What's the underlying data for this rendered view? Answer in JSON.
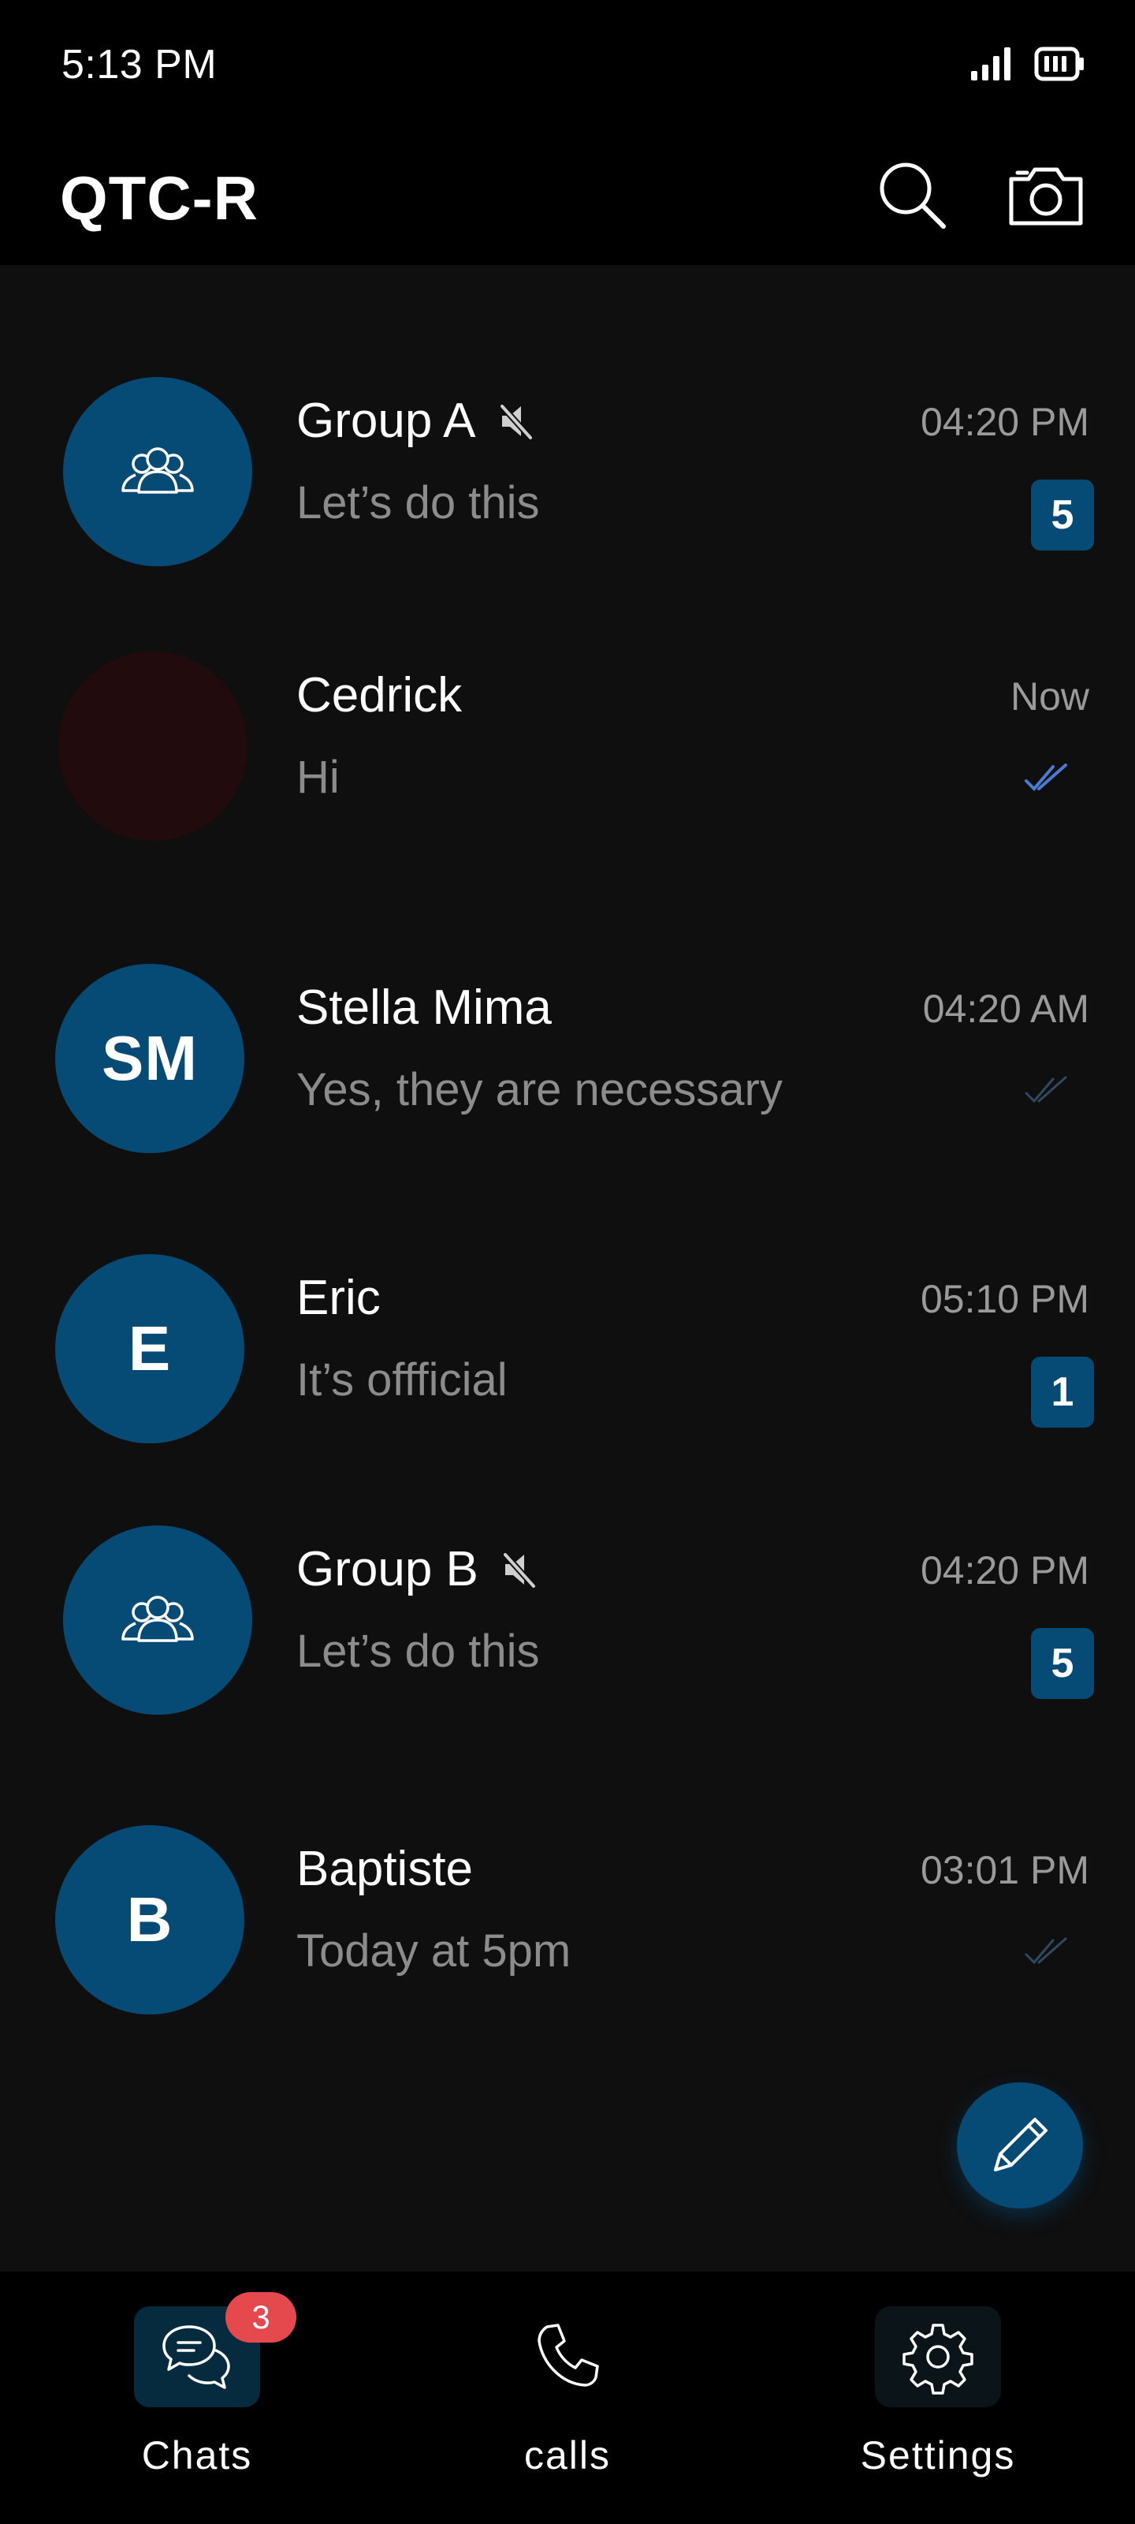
{
  "status_bar": {
    "time": "5:13 PM"
  },
  "header": {
    "title": "QTC-R"
  },
  "chats": [
    {
      "name": "Group A",
      "avatar_text": "",
      "avatar_type": "group-icon",
      "muted": true,
      "message": "Let’s do this",
      "time": "04:20 PM",
      "unread": "5",
      "read_status": null
    },
    {
      "name": "Cedrick",
      "avatar_text": "",
      "avatar_type": "photo",
      "muted": false,
      "message": "Hi",
      "time": "Now",
      "unread": null,
      "read_status": "read"
    },
    {
      "name": "Stella Mima",
      "avatar_text": "SM",
      "avatar_type": "initials",
      "muted": false,
      "message": "Yes, they are necessary",
      "time": "04:20 AM",
      "unread": null,
      "read_status": "delivered"
    },
    {
      "name": "Eric",
      "avatar_text": "E",
      "avatar_type": "initials",
      "muted": false,
      "message": "It’s offficial",
      "time": "05:10 PM",
      "unread": "1",
      "read_status": null
    },
    {
      "name": "Group B",
      "avatar_text": "",
      "avatar_type": "group-icon",
      "muted": true,
      "message": "Let’s do this",
      "time": "04:20 PM",
      "unread": "5",
      "read_status": null
    },
    {
      "name": "Baptiste",
      "avatar_text": "B",
      "avatar_type": "initials",
      "muted": false,
      "message": "Today at 5pm",
      "time": "03:01 PM",
      "unread": null,
      "read_status": "delivered"
    }
  ],
  "bottom_nav": {
    "chats_label": "Chats",
    "chats_badge": "3",
    "calls_label": "calls",
    "settings_label": "Settings"
  },
  "colors": {
    "accent": "#064a76",
    "background": "#0f0f0f",
    "bar": "#000000",
    "badge_red": "#e5484d",
    "read_tick": "#4a7bd0",
    "delivered_tick": "#2f4a5e"
  }
}
